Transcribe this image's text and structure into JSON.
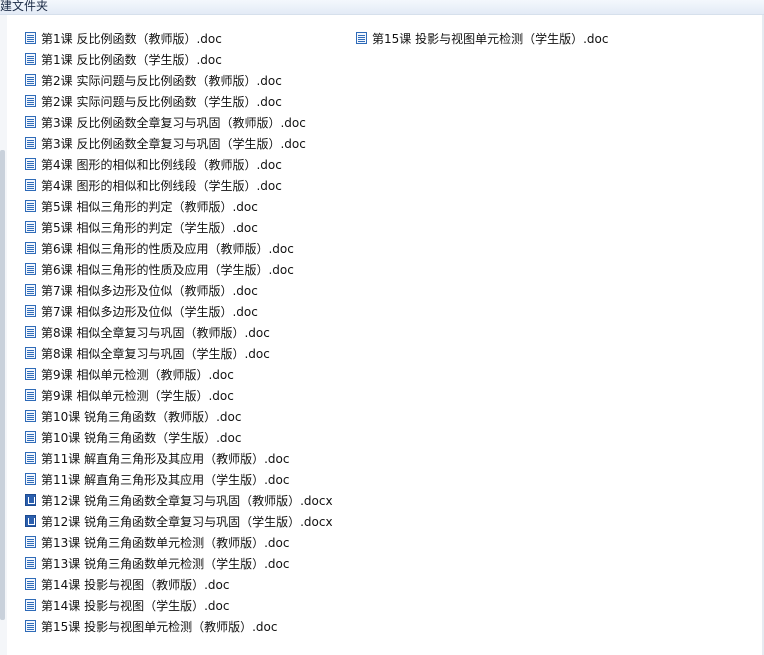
{
  "toolbar": {
    "title": "建文件夹"
  },
  "files": [
    {
      "name": "第1课  反比例函数（教师版）.doc",
      "type": "doc"
    },
    {
      "name": "第1课  反比例函数（学生版）.doc",
      "type": "doc"
    },
    {
      "name": "第2课  实际问题与反比例函数（教师版）.doc",
      "type": "doc"
    },
    {
      "name": "第2课  实际问题与反比例函数（学生版）.doc",
      "type": "doc"
    },
    {
      "name": "第3课  反比例函数全章复习与巩固（教师版）.doc",
      "type": "doc"
    },
    {
      "name": "第3课  反比例函数全章复习与巩固（学生版）.doc",
      "type": "doc"
    },
    {
      "name": "第4课  图形的相似和比例线段（教师版）.doc",
      "type": "doc"
    },
    {
      "name": "第4课  图形的相似和比例线段（学生版）.doc",
      "type": "doc"
    },
    {
      "name": "第5课  相似三角形的判定（教师版）.doc",
      "type": "doc"
    },
    {
      "name": "第5课  相似三角形的判定（学生版）.doc",
      "type": "doc"
    },
    {
      "name": "第6课  相似三角形的性质及应用（教师版）.doc",
      "type": "doc"
    },
    {
      "name": "第6课  相似三角形的性质及应用（学生版）.doc",
      "type": "doc"
    },
    {
      "name": "第7课  相似多边形及位似（教师版）.doc",
      "type": "doc"
    },
    {
      "name": "第7课  相似多边形及位似（学生版）.doc",
      "type": "doc"
    },
    {
      "name": "第8课  相似全章复习与巩固（教师版）.doc",
      "type": "doc"
    },
    {
      "name": "第8课  相似全章复习与巩固（学生版）.doc",
      "type": "doc"
    },
    {
      "name": "第9课  相似单元检测（教师版）.doc",
      "type": "doc"
    },
    {
      "name": "第9课  相似单元检测（学生版）.doc",
      "type": "doc"
    },
    {
      "name": "第10课  锐角三角函数（教师版）.doc",
      "type": "doc"
    },
    {
      "name": "第10课  锐角三角函数（学生版）.doc",
      "type": "doc"
    },
    {
      "name": "第11课  解直角三角形及其应用（教师版）.doc",
      "type": "doc"
    },
    {
      "name": "第11课  解直角三角形及其应用（学生版）.doc",
      "type": "doc"
    },
    {
      "name": "第12课  锐角三角函数全章复习与巩固（教师版）.docx",
      "type": "docx"
    },
    {
      "name": "第12课  锐角三角函数全章复习与巩固（学生版）.docx",
      "type": "docx"
    },
    {
      "name": "第13课  锐角三角函数单元检测（教师版）.doc",
      "type": "doc"
    },
    {
      "name": "第13课  锐角三角函数单元检测（学生版）.doc",
      "type": "doc"
    },
    {
      "name": "第14课  投影与视图（教师版）.doc",
      "type": "doc"
    },
    {
      "name": "第14课  投影与视图（学生版）.doc",
      "type": "doc"
    },
    {
      "name": "第15课  投影与视图单元检测（教师版）.doc",
      "type": "doc"
    },
    {
      "name": "第15课  投影与视图单元检测（学生版）.doc",
      "type": "doc"
    }
  ]
}
